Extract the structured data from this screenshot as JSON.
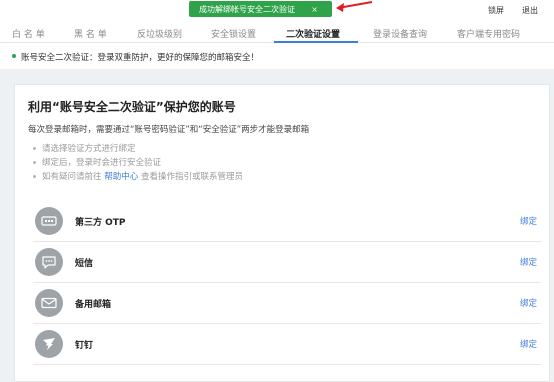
{
  "toast": {
    "message": "成功解绑帐号安全二次验证",
    "close": "×"
  },
  "top_links": {
    "lock": "锁屏",
    "logout": "退出"
  },
  "tabs": [
    {
      "label": "白 名 单",
      "active": false
    },
    {
      "label": "黑 名 单",
      "active": false
    },
    {
      "label": "反垃圾级别",
      "active": false
    },
    {
      "label": "安全锁设置",
      "active": false
    },
    {
      "label": "二次验证设置",
      "active": true
    },
    {
      "label": "登录设备查询",
      "active": false
    },
    {
      "label": "客户端专用密码",
      "active": false
    }
  ],
  "notice": {
    "text": "账号安全二次验证：登录双重防护，更好的保障您的邮箱安全！"
  },
  "card": {
    "title": "利用“账号安全二次验证”保护您的账号",
    "desc": "每次登录邮箱时，需要通过“账号密码验证”和“安全验证”两步才能登录邮箱",
    "hints": {
      "h1": "请选择验证方式进行绑定",
      "h2": "绑定后，登录时会进行安全验证",
      "h3_prefix": "如有疑问请前往",
      "h3_link": "帮助中心",
      "h3_suffix": "查看操作指引或联系管理员"
    },
    "methods": [
      {
        "label": "第三方 OTP",
        "action": "绑定",
        "icon": "otp-icon"
      },
      {
        "label": "短信",
        "action": "绑定",
        "icon": "sms-icon"
      },
      {
        "label": "备用邮箱",
        "action": "绑定",
        "icon": "mail-icon"
      },
      {
        "label": "钉钉",
        "action": "绑定",
        "icon": "dingtalk-icon"
      }
    ]
  },
  "colors": {
    "accent": "#3e7edb",
    "success": "#2fa34a",
    "icon_bg": "#9ea3a8",
    "arrow": "#e02020"
  }
}
